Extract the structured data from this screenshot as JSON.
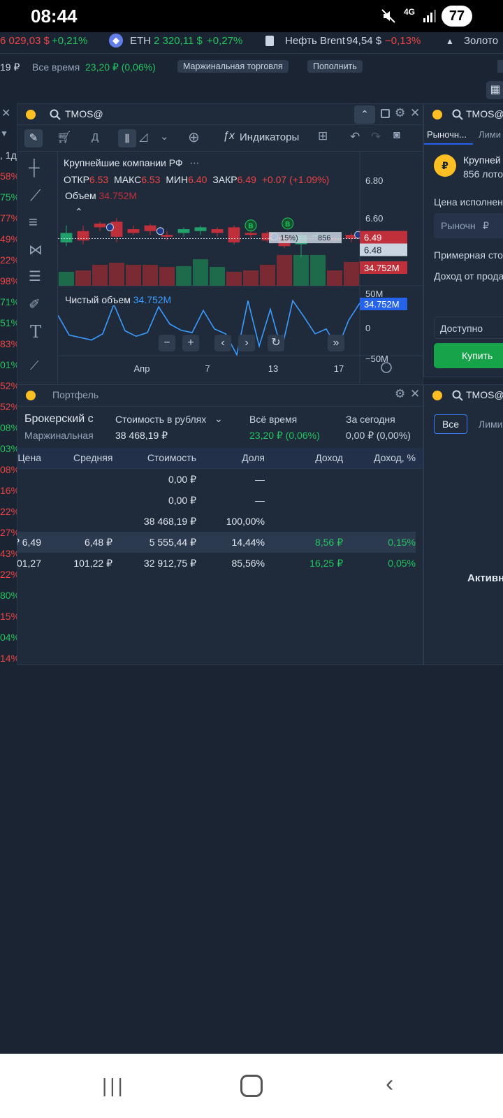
{
  "status": {
    "time": "08:44",
    "net": "4G",
    "battery": "77"
  },
  "ticker": {
    "first_value": "6 029,03 $",
    "first_change": "+0,21%",
    "eth_name": "ETH",
    "eth_value": "2 320,11 $",
    "eth_change": "+0,27%",
    "oil_name": "Нефть Brent",
    "oil_value": "94,54 $",
    "oil_change": "−0,13%",
    "gold_name": "Золото"
  },
  "account": {
    "partial": "19 ₽",
    "alltime_label": "Все время",
    "alltime_value": "23,20 ₽ (0,06%)",
    "margin_btn": "Маржинальная торговля",
    "topup_btn": "Пополнить"
  },
  "left_strip": {
    "timeframe": ", 1д",
    "pcts": [
      "58%",
      "75%",
      "77%",
      "49%",
      "22%",
      "98%",
      "71%",
      "51%",
      "83%",
      "01%",
      "52%",
      "52%",
      "08%",
      "03%",
      "08%",
      "16%",
      "22%",
      "27%",
      "43%",
      "22%",
      "80%",
      "15%",
      "04%",
      "14%"
    ]
  },
  "chart": {
    "symbol": "TMOS@",
    "period": "Д",
    "indicators_label": "Индикаторы",
    "instrument": "Крупнейшие компании РФ",
    "open_label": "ОТКР",
    "open": "6.53",
    "high_label": "МАКС",
    "high": "6.53",
    "low_label": "МИН",
    "low": "6.40",
    "close_label": "ЗАКР",
    "close": "6.49",
    "change": "+0.07 (+1.09%)",
    "volume_label": "Объем",
    "volume": "34.752M",
    "net_volume_label": "Чистый объем",
    "net_volume": "34.752M",
    "price_ticks": [
      "6.80",
      "6.60"
    ],
    "last_price": "6.49",
    "bid_price": "6.48",
    "vol_badge": "34.752M",
    "net_badge": "34.752M",
    "osc_ticks": [
      "50M",
      "0",
      "−50M"
    ],
    "dates": [
      "Апр",
      "7",
      "13",
      "17"
    ],
    "marker": "B",
    "order_pct": "15%)",
    "order_lots": "856"
  },
  "chart_data": {
    "type": "candlestick",
    "candles": [
      {
        "o": 6.47,
        "c": 6.52,
        "h": 6.56,
        "l": 6.45
      },
      {
        "o": 6.53,
        "c": 6.48,
        "h": 6.56,
        "l": 6.46
      },
      {
        "o": 6.57,
        "c": 6.55,
        "h": 6.58,
        "l": 6.53
      },
      {
        "o": 6.58,
        "c": 6.5,
        "h": 6.6,
        "l": 6.47
      },
      {
        "o": 6.54,
        "c": 6.52,
        "h": 6.56,
        "l": 6.51
      },
      {
        "o": 6.56,
        "c": 6.53,
        "h": 6.57,
        "l": 6.51
      },
      {
        "o": 6.51,
        "c": 6.5,
        "h": 6.53,
        "l": 6.48
      },
      {
        "o": 6.52,
        "c": 6.54,
        "h": 6.55,
        "l": 6.5
      },
      {
        "o": 6.53,
        "c": 6.55,
        "h": 6.56,
        "l": 6.51
      },
      {
        "o": 6.54,
        "c": 6.52,
        "h": 6.55,
        "l": 6.5
      },
      {
        "o": 6.55,
        "c": 6.47,
        "h": 6.56,
        "l": 6.46
      },
      {
        "o": 6.52,
        "c": 6.51,
        "h": 6.53,
        "l": 6.49
      },
      {
        "o": 6.52,
        "c": 6.48,
        "h": 6.53,
        "l": 6.47
      },
      {
        "o": 6.5,
        "c": 6.45,
        "h": 6.51,
        "l": 6.44
      },
      {
        "o": 6.46,
        "c": 6.51,
        "h": 6.52,
        "l": 6.39
      },
      {
        "o": 6.5,
        "c": 6.51,
        "h": 6.52,
        "l": 6.48
      },
      {
        "o": 6.49,
        "c": 6.48,
        "h": 6.5,
        "l": 6.47
      },
      {
        "o": 6.51,
        "c": 6.49,
        "h": 6.52,
        "l": 6.47
      }
    ],
    "volume_dirs": [
      1,
      0,
      0,
      0,
      0,
      0,
      0,
      1,
      1,
      1,
      0,
      0,
      0,
      0,
      1,
      1,
      0,
      0
    ],
    "volume_values": [
      20,
      22,
      30,
      33,
      30,
      30,
      27,
      28,
      38,
      27,
      20,
      22,
      30,
      44,
      44,
      44,
      22,
      34
    ],
    "net_volume_series": [
      20,
      -12,
      -16,
      -20,
      -10,
      38,
      -5,
      -14,
      -8,
      34,
      6,
      -4,
      -8,
      28,
      -2,
      -10,
      -44,
      44,
      -30,
      30,
      -36,
      44,
      18,
      -10,
      -2,
      -34,
      12,
      40
    ],
    "ylim": [
      6.34,
      6.84
    ],
    "osc_ylim": [
      -50,
      50
    ]
  },
  "order_panel": {
    "symbol": "TMOS@",
    "tab_market": "Рыночн...",
    "tab_limit": "Лими",
    "instrument": "Крупней",
    "lots": "856 лото",
    "exec_price_label": "Цена исполнен",
    "market_input": "Рыночн",
    "currency": "₽",
    "approx_cost_label": "Примерная сто",
    "income_label": "Доход от прода",
    "available_label": "Доступно",
    "buy_btn": "Купить"
  },
  "right_lower": {
    "symbol": "TMOS@",
    "tab_all": "Все",
    "tab_limit": "Лими",
    "active": "Активн"
  },
  "portfolio": {
    "title": "Портфель",
    "account_name": "Брокерский с",
    "account_type": "Маржинальная",
    "value_label": "Стоимость в рублях",
    "value": "38 468,19 ₽",
    "alltime_label": "Всё время",
    "alltime": "23,20 ₽ (0,06%)",
    "today_label": "За сегодня",
    "today": "0,00 ₽ (0,00%)",
    "columns": [
      "Цена",
      "Средняя",
      "Стоимость",
      "Доля",
      "Доход",
      "Доход, %"
    ],
    "rows": [
      {
        "price": "",
        "avg": "",
        "cost": "0,00 ₽",
        "share": "—",
        "income": "",
        "income_pct": ""
      },
      {
        "price": "",
        "avg": "",
        "cost": "0,00 ₽",
        "share": "—",
        "income": "",
        "income_pct": ""
      },
      {
        "price": "",
        "avg": "",
        "cost": "38 468,19 ₽",
        "share": "100,00%",
        "income": "",
        "income_pct": ""
      },
      {
        "price": "6,49 ₽",
        "avg": "6,48 ₽",
        "cost": "5 555,44 ₽",
        "share": "14,44%",
        "income": "8,56 ₽",
        "income_pct": "0,15%"
      },
      {
        "price": "101,27 ₽",
        "avg": "101,22 ₽",
        "cost": "32 912,75 ₽",
        "share": "85,56%",
        "income": "16,25 ₽",
        "income_pct": "0,05%"
      }
    ]
  },
  "lower_panel": {
    "symbol": "TMOS@"
  },
  "colors": {
    "up": "#22a06b",
    "down": "#c0303a",
    "accent": "#2563eb",
    "buy": "#16a34a",
    "bg": "#1b2433"
  }
}
